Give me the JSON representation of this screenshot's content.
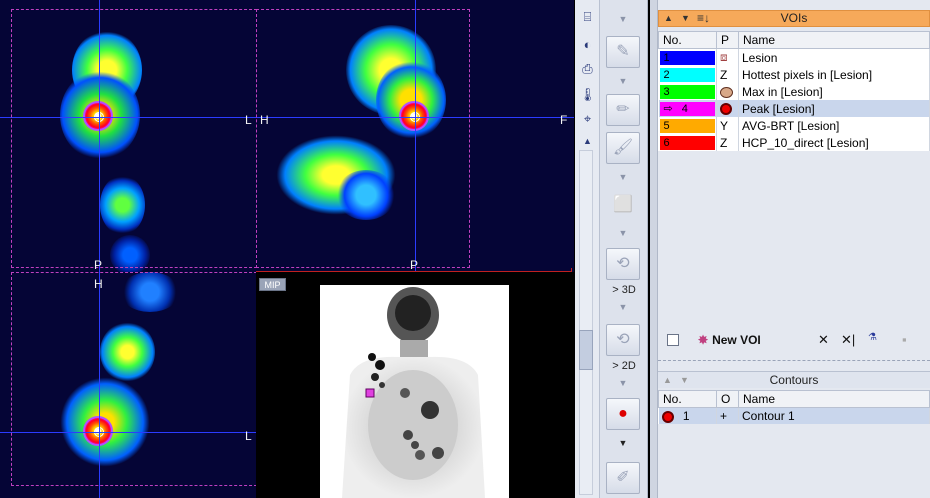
{
  "orientation": {
    "coronal_right": "L",
    "coronal_bottom": "P",
    "sagittal_left": "H",
    "sagittal_right": "F",
    "sagittal_bottom": "P",
    "axial_top": "H",
    "axial_right": "L"
  },
  "mip_label": "MIP",
  "middle": {
    "to_3d": "> 3D",
    "to_2d": "> 2D"
  },
  "vois": {
    "title": "VOIs",
    "headers": [
      "No.",
      "P",
      "Name"
    ],
    "rows": [
      {
        "no": "1",
        "p": "",
        "name": "Lesion",
        "color": "#0000ff"
      },
      {
        "no": "2",
        "p": "Z",
        "name": "Hottest pixels in [Lesion]",
        "color": "#00ffff"
      },
      {
        "no": "3",
        "p": "",
        "name": "Max in [Lesion]",
        "color": "#00ff00"
      },
      {
        "no": "4",
        "p": "",
        "name": "Peak [Lesion]",
        "color": "#ff00ff"
      },
      {
        "no": "5",
        "p": "Y",
        "name": "AVG-BRT [Lesion]",
        "color": "#ffaa00"
      },
      {
        "no": "6",
        "p": "Z",
        "name": "HCP_10_direct [Lesion]",
        "color": "#ff0000"
      }
    ]
  },
  "toolbar": {
    "new_voi": "New VOI"
  },
  "contours": {
    "title": "Contours",
    "headers": [
      "No.",
      "O",
      "Name"
    ],
    "rows": [
      {
        "no": "1",
        "o": "+",
        "name": "Contour 1"
      }
    ]
  }
}
